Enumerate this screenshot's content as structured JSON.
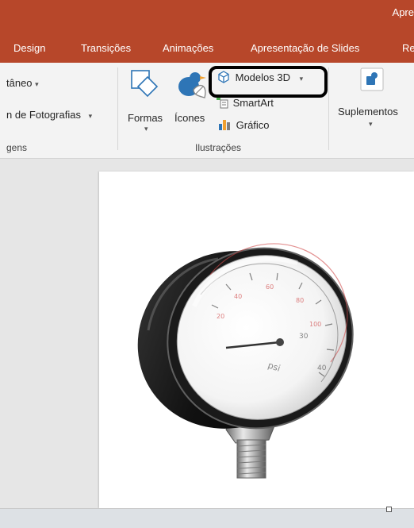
{
  "window": {
    "title": "Apre"
  },
  "tabs": [
    "Design",
    "Transições",
    "Animações",
    "Apresentação de Slides",
    "Re"
  ],
  "ribbon": {
    "imagens": {
      "album_partial": "tâneo",
      "album_full": "n de Fotografias",
      "group_label": "gens"
    },
    "ilustracoes": {
      "formas": "Formas",
      "icones": "Ícones",
      "modelos3d": "Modelos 3D",
      "smartart": "SmartArt",
      "grafico": "Gráfico",
      "group_label": "Ilustrações"
    },
    "suplementos": {
      "label": "Suplementos"
    }
  },
  "slide": {
    "gauge": {
      "unit": "psi"
    }
  },
  "colors": {
    "accent": "#b7472a",
    "ribbon_bg": "#f3f3f3",
    "workspace_bg": "#e6e6e6",
    "highlight": "#000000"
  }
}
